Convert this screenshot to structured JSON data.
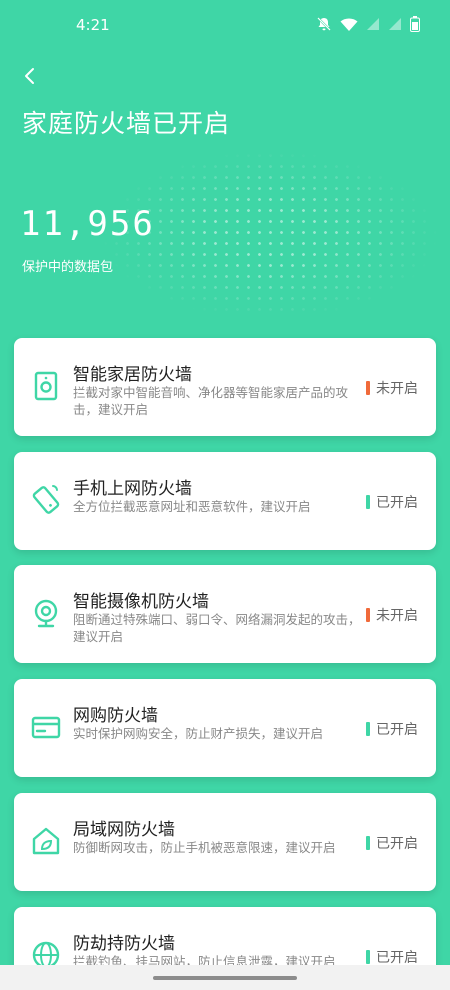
{
  "status_bar": {
    "time": "4:21"
  },
  "header": {
    "title": "家庭防火墙已开启",
    "counter_value": "11,956",
    "counter_label": "保护中的数据包"
  },
  "colors": {
    "accent": "#3fd6a6",
    "status_off": "#f06a3a",
    "status_on": "#3fd6a6"
  },
  "cards": [
    {
      "icon": "smart-speaker-icon",
      "title": "智能家居防火墙",
      "desc": "拦截对家中智能音响、净化器等智能家居产品的攻击，建议开启",
      "status": "未开启",
      "on": false
    },
    {
      "icon": "phone-shield-icon",
      "title": "手机上网防火墙",
      "desc": "全方位拦截恶意网址和恶意软件，建议开启",
      "status": "已开启",
      "on": true
    },
    {
      "icon": "camera-icon",
      "title": "智能摄像机防火墙",
      "desc": "阻断通过特殊端口、弱口令、网络漏洞发起的攻击，建议开启",
      "status": "未开启",
      "on": false
    },
    {
      "icon": "card-icon",
      "title": "网购防火墙",
      "desc": "实时保护网购安全，防止财产损失，建议开启",
      "status": "已开启",
      "on": true
    },
    {
      "icon": "home-leaf-icon",
      "title": "局域网防火墙",
      "desc": "防御断网攻击，防止手机被恶意限速，建议开启",
      "status": "已开启",
      "on": true
    },
    {
      "icon": "globe-icon",
      "title": "防劫持防火墙",
      "desc": "拦截钓鱼、挂马网站，防止信息泄露，建议开启",
      "status": "已开启",
      "on": true
    }
  ]
}
